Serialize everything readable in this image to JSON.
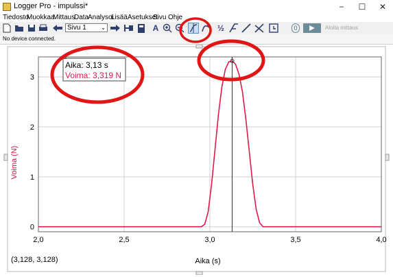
{
  "window": {
    "title": "Logger Pro - impulssi*",
    "minimize": "−",
    "maximize": "☐",
    "close": "✕"
  },
  "menu": [
    "Tiedosto",
    "Muokkaa",
    "Mittaus",
    "Data",
    "Analysoi",
    "Lisää",
    "Asetukset",
    "Sivu",
    "Ohje"
  ],
  "toolbar": {
    "page_select": "Sivu 1",
    "fraction_tool": "½",
    "zero_label": "0",
    "collect_label": "Aloita mittaus",
    "tools": [
      "new-file-icon",
      "open-folder-icon",
      "save-icon",
      "print-icon",
      "back-arrow-icon",
      "forward-arrow-icon",
      "table-icon",
      "calculator-icon",
      "autoscale-icon",
      "zoom-in-icon",
      "zoom-out-icon",
      "examine-icon",
      "tangent-icon",
      "integral-icon",
      "linear-fit-icon",
      "curve-fit-icon",
      "clock-icon"
    ]
  },
  "status": {
    "text": "No device connected."
  },
  "examine": {
    "time_label": "Aika: 3,13 s",
    "force_label": "Voima: 3,319 N"
  },
  "coordinates": "(3,128, 3,128)",
  "colors": {
    "series": "#e0184a",
    "annotation": "#e01515",
    "ylabel": "#d21a4a"
  },
  "chart_data": {
    "type": "line",
    "xlabel": "Aika (s)",
    "ylabel": "Voima (N)",
    "xlim": [
      2.0,
      4.0
    ],
    "ylim": [
      -0.1,
      3.4
    ],
    "xticks": [
      "2,0",
      "2,5",
      "3,0",
      "3,5",
      "4,0"
    ],
    "yticks": [
      "0",
      "1",
      "2",
      "3"
    ],
    "grid": true,
    "series": [
      {
        "x": [
          2.0,
          2.2,
          2.4,
          2.6,
          2.8,
          2.95,
          2.97,
          2.99,
          3.01,
          3.03,
          3.05,
          3.07,
          3.09,
          3.11,
          3.13,
          3.15,
          3.17,
          3.19,
          3.21,
          3.23,
          3.25,
          3.27,
          3.29,
          3.31,
          3.5,
          3.7,
          3.9,
          4.0
        ],
        "y": [
          0.0,
          0.0,
          0.0,
          0.0,
          0.0,
          0.0,
          0.05,
          0.3,
          0.85,
          1.55,
          2.25,
          2.8,
          3.15,
          3.3,
          3.319,
          3.25,
          3.05,
          2.7,
          2.15,
          1.5,
          0.85,
          0.35,
          0.08,
          0.0,
          0.0,
          0.0,
          0.0,
          0.0
        ]
      }
    ],
    "cursor_x": 3.13
  }
}
